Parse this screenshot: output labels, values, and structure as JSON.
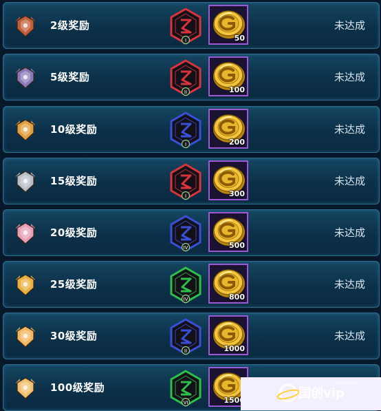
{
  "rewards": [
    {
      "label": "2级奖励",
      "amount": "50",
      "status": "未达成",
      "rank_color": "#c0603a",
      "rune_color": "#d9343c",
      "rune_numeral": "I"
    },
    {
      "label": "5级奖励",
      "amount": "100",
      "status": "未达成",
      "rank_color": "#8a7ab8",
      "rune_color": "#d9343c",
      "rune_numeral": "II"
    },
    {
      "label": "10级奖励",
      "amount": "200",
      "status": "未达成",
      "rank_color": "#e0a040",
      "rune_color": "#3a4fd8",
      "rune_numeral": "I"
    },
    {
      "label": "15级奖励",
      "amount": "300",
      "status": "未达成",
      "rank_color": "#b8c0c8",
      "rune_color": "#d9343c",
      "rune_numeral": "I"
    },
    {
      "label": "20级奖励",
      "amount": "500",
      "status": "未达成",
      "rank_color": "#e8a0b8",
      "rune_color": "#3a4fd8",
      "rune_numeral": "IV"
    },
    {
      "label": "25级奖励",
      "amount": "800",
      "status": "未达成",
      "rank_color": "#e8b040",
      "rune_color": "#2cc04a",
      "rune_numeral": "IV"
    },
    {
      "label": "30级奖励",
      "amount": "1000",
      "status": "未达成",
      "rank_color": "#f0b860",
      "rune_color": "#3a4fd8",
      "rune_numeral": "II"
    },
    {
      "label": "100级奖励",
      "amount": "1500",
      "status": "",
      "rank_color": "#f0c070",
      "rune_color": "#2cc04a",
      "rune_numeral": "VI"
    }
  ],
  "watermark": {
    "text": "国创vip",
    "small_text": "GUOCHUANGVIP"
  }
}
